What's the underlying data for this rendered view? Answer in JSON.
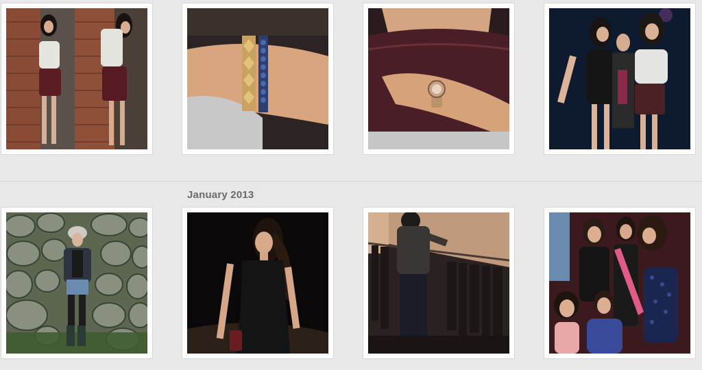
{
  "gallery": {
    "month_label": "January 2013"
  },
  "colors": {
    "background": "#e8e8e8",
    "tile_border": "#ffffff",
    "label_text": "#6b6b6b"
  }
}
